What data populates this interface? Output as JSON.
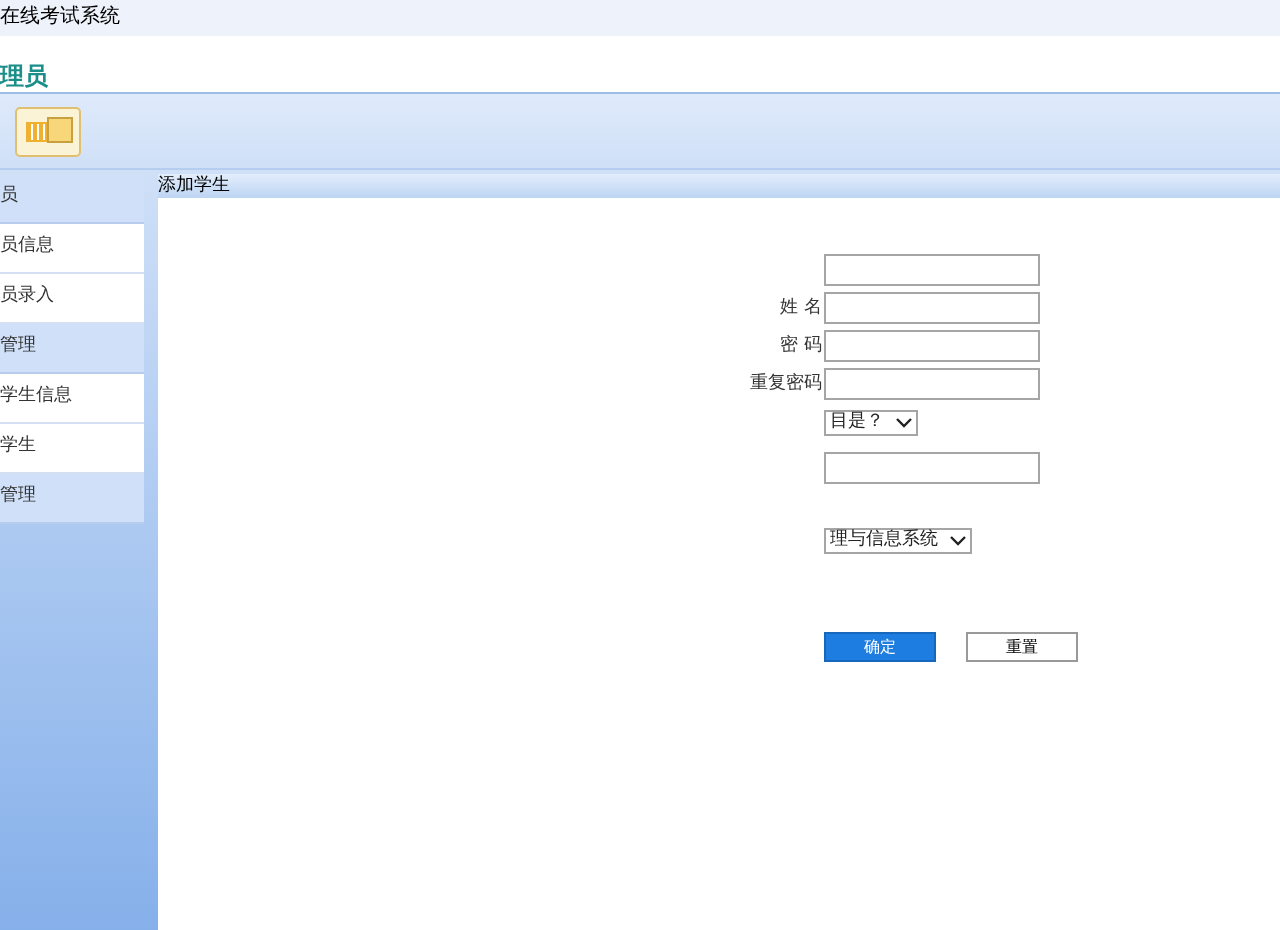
{
  "window": {
    "title": "在线考试系统"
  },
  "header": {
    "title": "理员"
  },
  "sidebar": {
    "items": [
      {
        "kind": "header",
        "label": "员"
      },
      {
        "kind": "link",
        "label": "员信息"
      },
      {
        "kind": "link",
        "label": "员录入"
      },
      {
        "kind": "header",
        "label": "管理"
      },
      {
        "kind": "link",
        "label": "学生信息"
      },
      {
        "kind": "link",
        "label": "学生"
      },
      {
        "kind": "header",
        "label": "管理"
      }
    ]
  },
  "panel": {
    "title": "添加学生"
  },
  "form": {
    "fields": [
      {
        "kind": "text"
      },
      {
        "kind": "text",
        "label": "姓 名"
      },
      {
        "kind": "text",
        "label": "密 码"
      },
      {
        "kind": "text",
        "label": "重复密码"
      },
      {
        "kind": "select",
        "value": "目是？"
      },
      {
        "kind": "text"
      },
      {
        "kind": "select",
        "value": "理与信息系统"
      }
    ]
  },
  "buttons": [
    {
      "kind": "primary",
      "label": "确定"
    },
    {
      "kind": "secondary",
      "label": "重置"
    }
  ]
}
